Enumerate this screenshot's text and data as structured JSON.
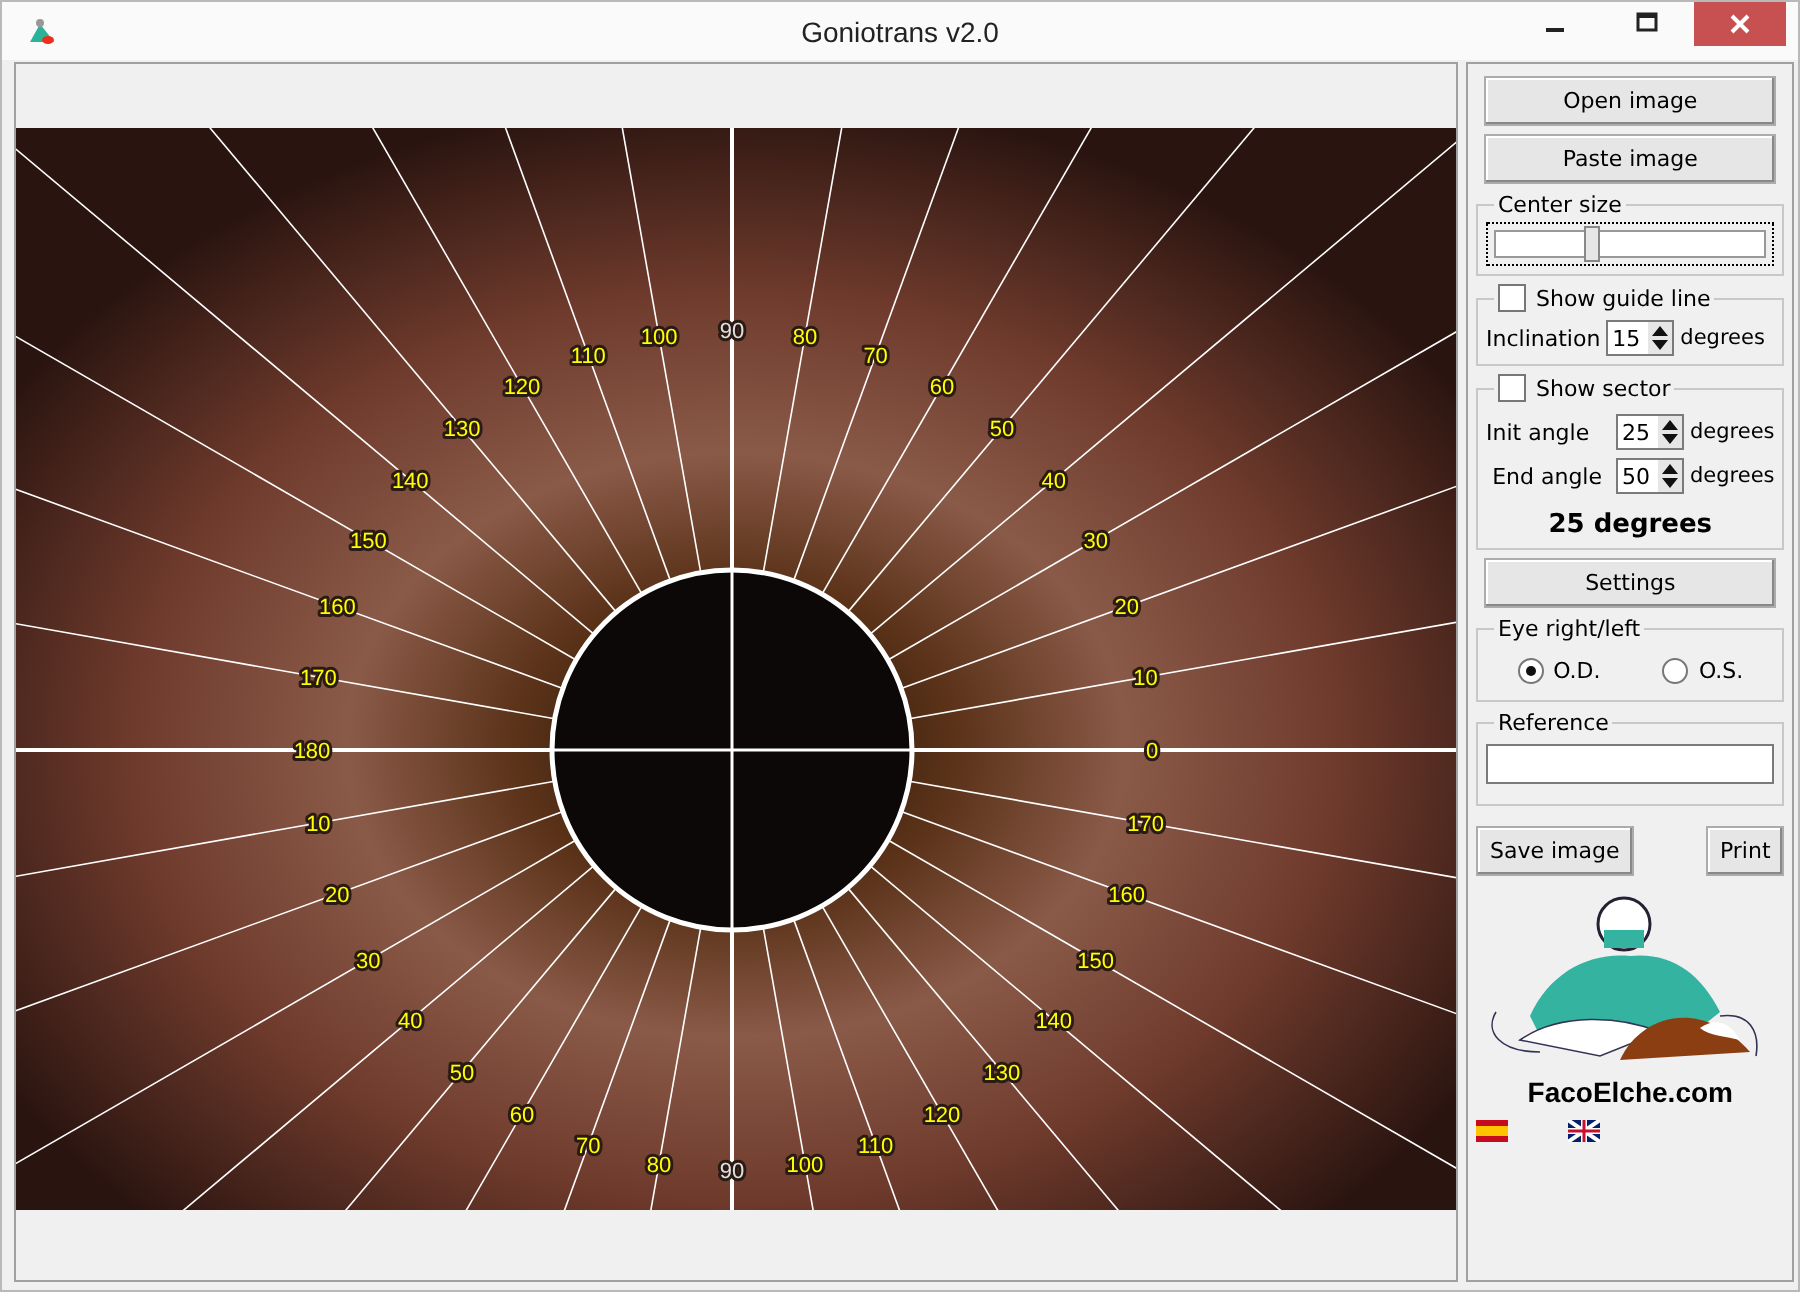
{
  "window": {
    "title": "Goniotrans v2.0"
  },
  "dial": {
    "top_label": "90",
    "left_labels": [
      "100",
      "110",
      "120",
      "130",
      "140",
      "150",
      "160",
      "170",
      "180",
      "10",
      "20",
      "30",
      "40",
      "50",
      "60",
      "70",
      "80"
    ],
    "right_labels": [
      "80",
      "70",
      "60",
      "50",
      "40",
      "30",
      "20",
      "10",
      "0",
      "170",
      "160",
      "150",
      "140",
      "130",
      "120",
      "110",
      "100"
    ],
    "bottom_label": "90"
  },
  "open_button": "Open image",
  "paste_button": "Paste image",
  "center_size": {
    "label": "Center size",
    "level": 0.33
  },
  "guide_line": {
    "label": "Show guide line",
    "checked": false,
    "inclination_label": "Inclination",
    "inclination": "15",
    "unit": "degrees"
  },
  "sector": {
    "label": "Show sector",
    "checked": false,
    "init_label": "Init angle",
    "init": "25",
    "init_unit": "degrees",
    "end_label": "End angle",
    "end": "50",
    "end_unit": "degrees",
    "result": "25 degrees"
  },
  "settings_button": "Settings",
  "eye": {
    "label": "Eye right/left",
    "options": [
      {
        "label": "O.D.",
        "selected": true
      },
      {
        "label": "O.S.",
        "selected": false
      }
    ]
  },
  "reference": {
    "label": "Reference"
  },
  "save_button": "Save image",
  "print_button": "Print",
  "logo_text": "FacoElche.com"
}
